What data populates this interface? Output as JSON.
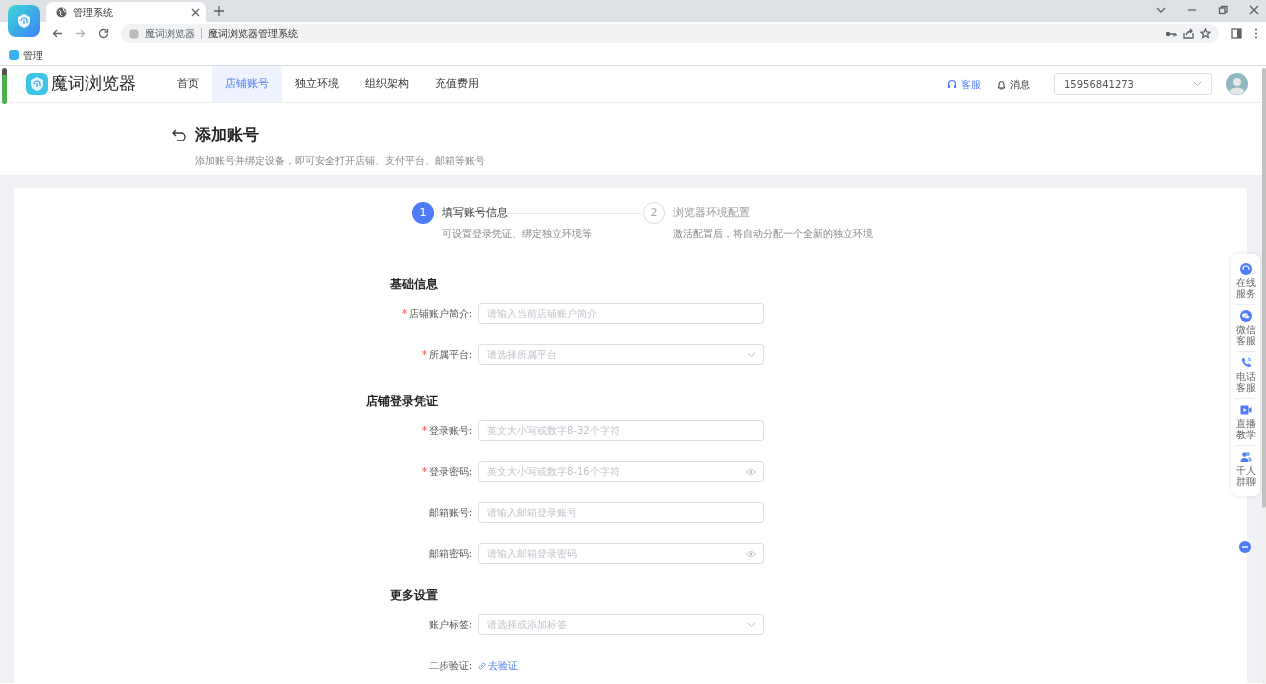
{
  "browser": {
    "tab": {
      "title": "管理系统"
    },
    "address_bar": {
      "site": "魔词浏览器",
      "title": "魔词浏览器管理系统"
    },
    "bookmarks": [
      {
        "label": "管理"
      }
    ]
  },
  "header": {
    "logo_text": "魔词浏览器",
    "nav": [
      {
        "label": "首页",
        "selected": false
      },
      {
        "label": "店铺账号",
        "selected": true
      },
      {
        "label": "独立环境",
        "selected": false
      },
      {
        "label": "组织架构",
        "selected": false
      },
      {
        "label": "充值费用",
        "selected": false
      }
    ],
    "service": "客服",
    "messages": "消息",
    "account": "15956841273"
  },
  "page": {
    "title": "添加账号",
    "subtitle": "添加账号并绑定设备，即可安全打开店铺、支付平台、邮箱等账号"
  },
  "steps": [
    {
      "number": "1",
      "title": "填写账号信息",
      "description": "可设置登录凭证、绑定独立环境等",
      "selected": true
    },
    {
      "number": "2",
      "title": "浏览器环境配置",
      "description": "激活配置后，将自动分配一个全新的独立环境",
      "selected": false
    }
  ],
  "sections": [
    {
      "title": "基础信息",
      "fields": [
        {
          "kind": "input",
          "label": "店铺账户简介:",
          "required": true,
          "placeholder": "请输入当前店铺账户简介"
        },
        {
          "kind": "select",
          "label": "所属平台:",
          "required": true,
          "placeholder": "请选择所属平台"
        }
      ]
    },
    {
      "title": "店铺登录凭证",
      "fields": [
        {
          "kind": "input",
          "label": "登录账号:",
          "required": true,
          "placeholder": "英文大小写或数字8-32个字符"
        },
        {
          "kind": "password",
          "label": "登录密码:",
          "required": true,
          "placeholder": "英文大小写或数字8-16个字符"
        },
        {
          "kind": "input",
          "label": "邮箱账号:",
          "required": false,
          "placeholder": "请输入邮箱登录账号"
        },
        {
          "kind": "password",
          "label": "邮箱密码:",
          "required": false,
          "placeholder": "请输入邮箱登录密码"
        }
      ]
    },
    {
      "title": "更多设置",
      "fields": [
        {
          "kind": "select",
          "label": "账户标签:",
          "required": false,
          "placeholder": "请选择或添加标签"
        },
        {
          "kind": "link",
          "label": "二步验证:",
          "required": false,
          "link_text": "去验证"
        }
      ]
    }
  ],
  "float_tools": [
    {
      "label": "在线服务"
    },
    {
      "label": "微信客服"
    },
    {
      "label": "电话客服"
    },
    {
      "label": "直播教学"
    },
    {
      "label": "千人群聊"
    }
  ]
}
